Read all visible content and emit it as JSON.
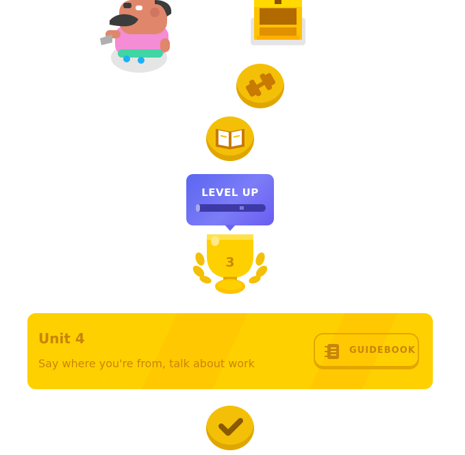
{
  "path": {
    "nodes": [
      {
        "name": "dumbbell-practice-node",
        "icon": "dumbbell-icon",
        "state": "completed"
      },
      {
        "name": "story-node",
        "icon": "book-icon",
        "state": "completed"
      }
    ],
    "level_up": {
      "label": "LEVEL UP",
      "progress": 0.04
    },
    "trophy": {
      "level_number": "3"
    },
    "final_node": {
      "icon": "checkmark-icon",
      "state": "completed"
    }
  },
  "unit": {
    "title": "Unit 4",
    "description": "Say where you're from, talk about work",
    "guidebook_label": "GUIDEBOOK"
  },
  "colors": {
    "gold": "#f4c007",
    "gold_dark": "#e0a600",
    "unit_bg": "#ffd000",
    "unit_text": "#c8850a",
    "level_up_bg": "#6a66f2"
  }
}
